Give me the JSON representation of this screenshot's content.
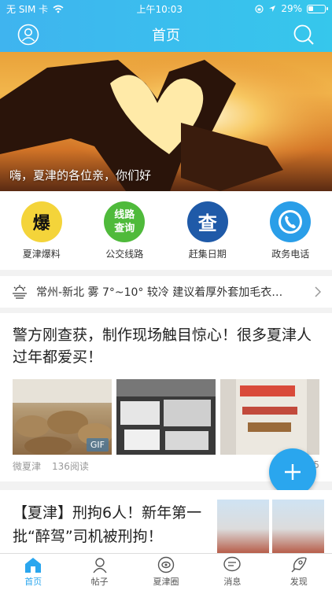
{
  "status_bar": {
    "carrier": "无 SIM 卡",
    "time": "上午10:03",
    "battery": "29%",
    "battery_level": 0.29
  },
  "nav": {
    "title": "首页",
    "left_icon": "user-icon",
    "right_icon": "search-icon",
    "accent_color": "#3fb4ef"
  },
  "banner": {
    "caption": "嗨，夏津的各位亲，你们好"
  },
  "quick_links": [
    {
      "label": "夏津爆料",
      "glyph": "爆",
      "icon": "explosion-icon",
      "color": "#f4d43a"
    },
    {
      "label": "公交线路",
      "glyph_line1": "线路",
      "glyph_line2": "查询",
      "icon": "bus-route-icon",
      "color": "#4fba3b"
    },
    {
      "label": "赶集日期",
      "glyph": "查",
      "icon": "market-date-icon",
      "color": "#1f5aa8"
    },
    {
      "label": "政务电话",
      "icon": "phone-icon",
      "color": "#2a9ee8"
    }
  ],
  "weather": {
    "text": "常州-新北 雾 7°~10° 较冷 建议着厚外套加毛衣…",
    "icon": "fog-weather-icon"
  },
  "posts": [
    {
      "headline": "警方刚查获，制作现场触目惊心！很多夏津人过年都爱买！",
      "badge": "GIF",
      "author": "微夏津",
      "reads": "136阅读",
      "extra_count": "5"
    },
    {
      "headline": "【夏津】刑拘6人！新年第一批“醉驾”司机被刑拘！"
    }
  ],
  "fab": {
    "icon": "plus-icon"
  },
  "tabbar": [
    {
      "label": "首页",
      "icon": "home-icon",
      "active": true
    },
    {
      "label": "帖子",
      "icon": "posts-icon"
    },
    {
      "label": "夏津圈",
      "icon": "circle-icon"
    },
    {
      "label": "消息",
      "icon": "message-icon"
    },
    {
      "label": "发现",
      "icon": "discover-icon"
    }
  ]
}
